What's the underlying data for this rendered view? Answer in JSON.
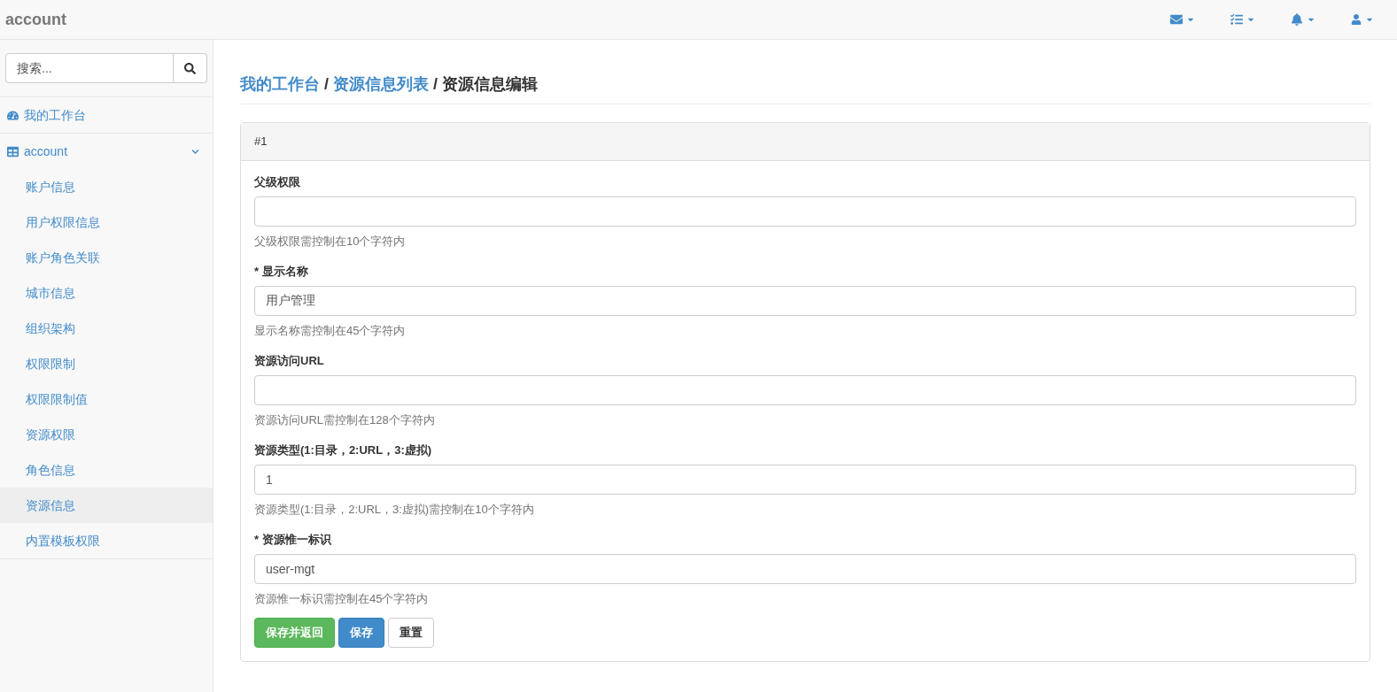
{
  "navbar": {
    "brand": "account",
    "menus": [
      {
        "kind": "mail"
      },
      {
        "kind": "tasks"
      },
      {
        "kind": "alerts"
      },
      {
        "kind": "user"
      }
    ]
  },
  "sidebar": {
    "search": {
      "placeholder": "搜索..."
    },
    "items": [
      {
        "kind": "dashboard",
        "label": "我的工作台"
      },
      {
        "kind": "table",
        "label": "account",
        "expanded": true,
        "children": [
          {
            "label": "账户信息",
            "selected": false
          },
          {
            "label": "用户权限信息",
            "selected": false
          },
          {
            "label": "账户角色关联",
            "selected": false
          },
          {
            "label": "城市信息",
            "selected": false
          },
          {
            "label": "组织架构",
            "selected": false
          },
          {
            "label": "权限限制",
            "selected": false
          },
          {
            "label": "权限限制值",
            "selected": false
          },
          {
            "label": "资源权限",
            "selected": false
          },
          {
            "label": "角色信息",
            "selected": false
          },
          {
            "label": "资源信息",
            "selected": true
          },
          {
            "label": "内置模板权限",
            "selected": false
          }
        ]
      }
    ]
  },
  "breadcrumb": [
    {
      "kind": "link",
      "label": "我的工作台"
    },
    {
      "kind": "separator",
      "label": "/"
    },
    {
      "kind": "link",
      "label": "资源信息列表"
    },
    {
      "kind": "separator",
      "label": "/"
    },
    {
      "kind": "current",
      "label": "资源信息编辑"
    }
  ],
  "panel": {
    "title": "#1",
    "fields": [
      {
        "label": "父级权限",
        "help": "父级权限需控制在10个字符内"
      },
      {
        "label": "* 显示名称",
        "value": "用户管理",
        "help": "显示名称需控制在45个字符内"
      },
      {
        "label": "资源访问URL",
        "help": "资源访问URL需控制在128个字符内"
      },
      {
        "label": "资源类型(1:目录，2:URL，3:虚拟)",
        "value": "1",
        "help": "资源类型(1:目录，2:URL，3:虚拟)需控制在10个字符内"
      },
      {
        "label": "* 资源惟一标识",
        "value": "user-mgt",
        "help": "资源惟一标识需控制在45个字符内"
      }
    ],
    "buttons": [
      {
        "kind": "success",
        "label": "保存并返回"
      },
      {
        "kind": "primary",
        "label": "保存"
      },
      {
        "kind": "default",
        "label": "重置"
      }
    ]
  }
}
